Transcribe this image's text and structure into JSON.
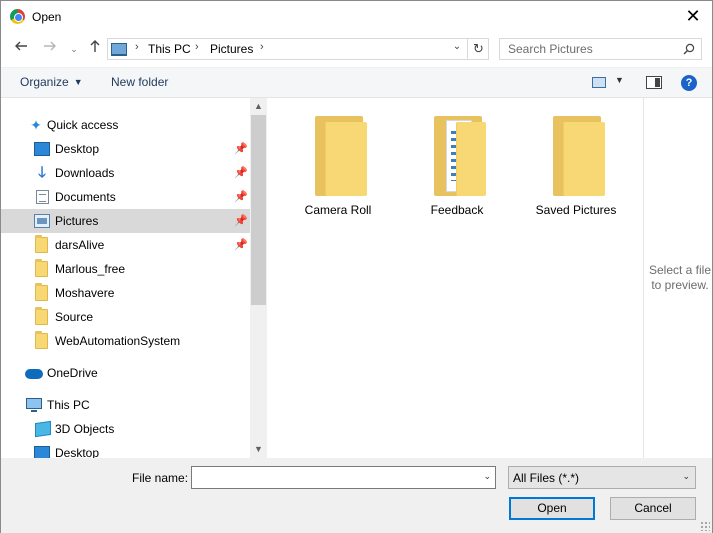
{
  "window": {
    "title": "Open"
  },
  "address": {
    "crumbs": [
      "This PC",
      "Pictures"
    ]
  },
  "search": {
    "placeholder": "Search Pictures"
  },
  "toolbar": {
    "organize": "Organize",
    "new_folder": "New folder"
  },
  "nav": {
    "items": [
      {
        "label": "Quick access",
        "icon": "star-icon"
      },
      {
        "label": "Desktop",
        "icon": "desktop-icon",
        "pinned": true
      },
      {
        "label": "Downloads",
        "icon": "download-icon",
        "pinned": true
      },
      {
        "label": "Documents",
        "icon": "documents-icon",
        "pinned": true
      },
      {
        "label": "Pictures",
        "icon": "pictures-icon",
        "pinned": true,
        "state": "hovered"
      },
      {
        "label": "darsAlive",
        "icon": "folder-icon",
        "pinned": true
      },
      {
        "label": "Marlous_free",
        "icon": "folder-icon"
      },
      {
        "label": "Moshavere",
        "icon": "folder-icon"
      },
      {
        "label": "Source",
        "icon": "folder-icon"
      },
      {
        "label": "WebAutomationSystem",
        "icon": "folder-icon"
      },
      {
        "label": "OneDrive",
        "icon": "cloud-icon"
      },
      {
        "label": "This PC",
        "icon": "computer-icon"
      },
      {
        "label": "3D Objects",
        "icon": "cube-icon"
      },
      {
        "label": "Desktop",
        "icon": "desktop-icon"
      }
    ]
  },
  "content": {
    "folders": [
      {
        "label": "Camera Roll"
      },
      {
        "label": "Feedback"
      },
      {
        "label": "Saved Pictures"
      }
    ]
  },
  "preview": {
    "message": "Select a file to preview."
  },
  "bottom": {
    "file_name_label": "File name:",
    "file_name_value": "",
    "file_type": "All Files (*.*)",
    "open_label": "Open",
    "cancel_label": "Cancel"
  },
  "colors": {
    "accent": "#0078d7",
    "hover": "#d9d9d9",
    "folder": "#f8d775"
  }
}
